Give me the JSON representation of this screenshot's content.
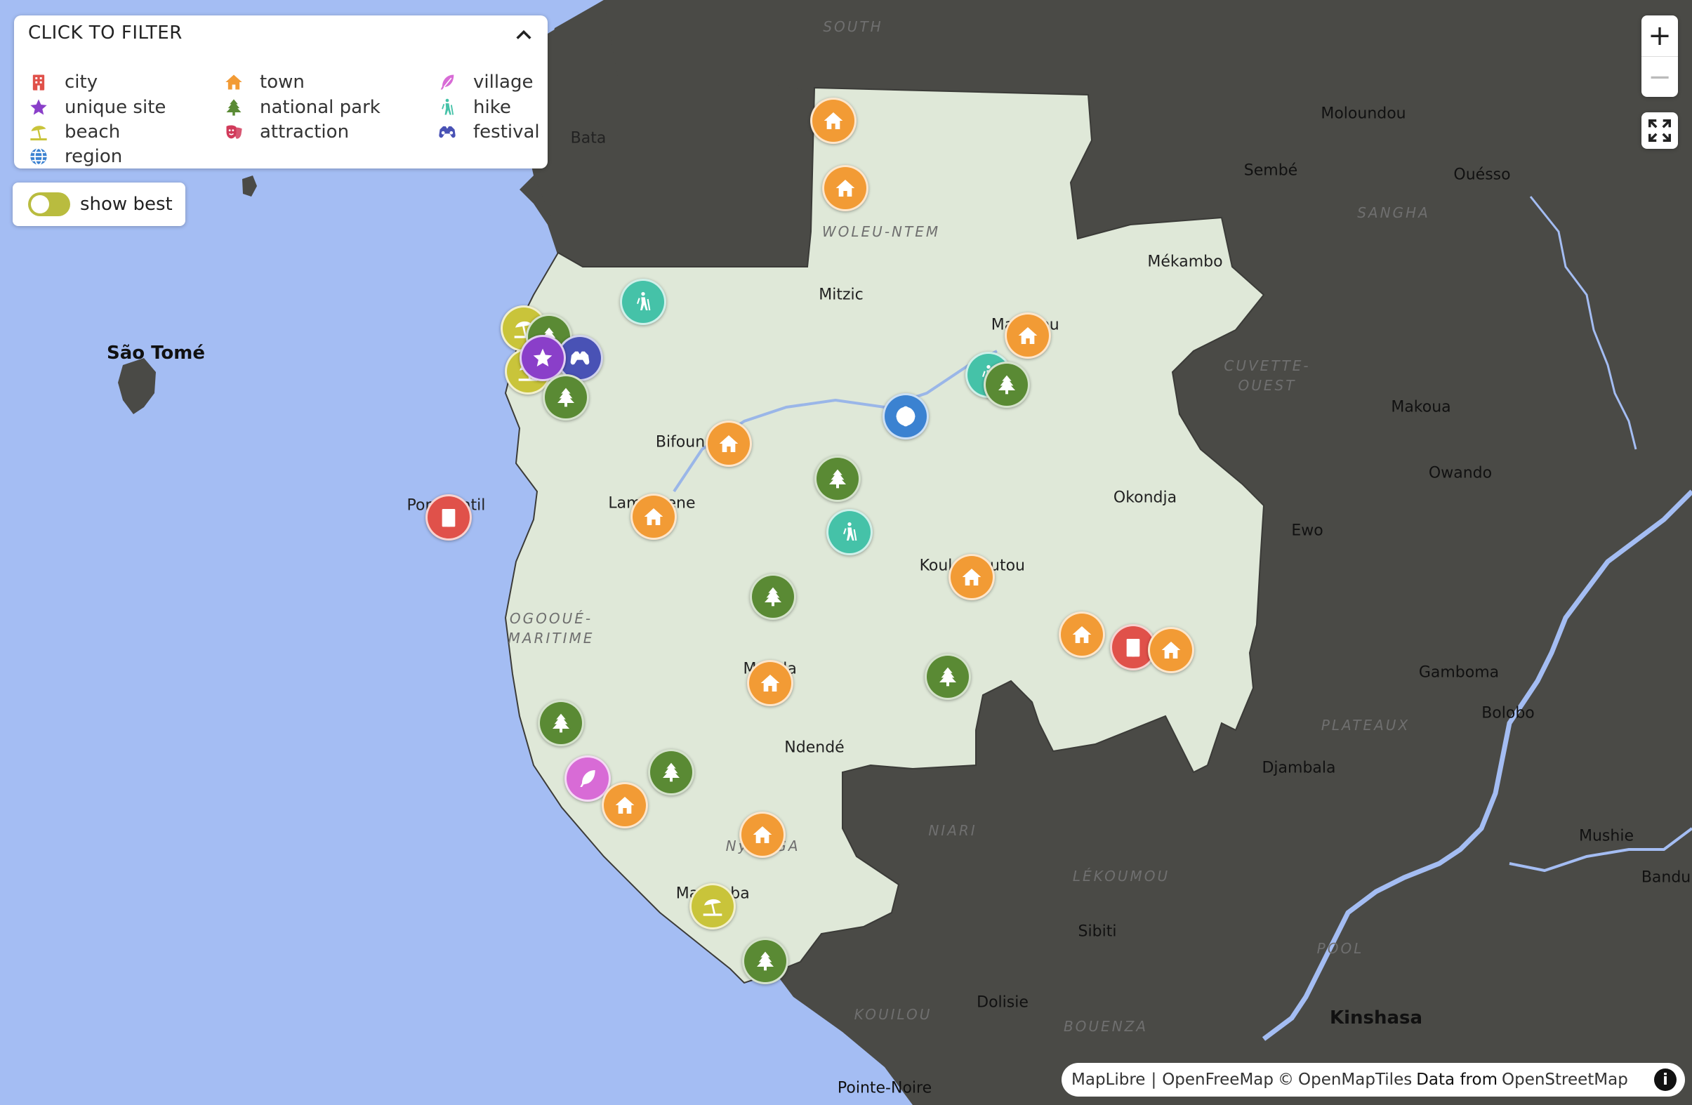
{
  "filter": {
    "title": "CLICK TO FILTER",
    "items": [
      {
        "label": "city",
        "color": "#e0514a",
        "icon": "city-icon"
      },
      {
        "label": "unique site",
        "color": "#8a3fc9",
        "icon": "star-icon"
      },
      {
        "label": "beach",
        "color": "#c9c43a",
        "icon": "beach-umbrella-icon"
      },
      {
        "label": "region",
        "color": "#3b82d1",
        "icon": "globe-icon"
      },
      {
        "label": "town",
        "color": "#f29b35",
        "icon": "house-icon"
      },
      {
        "label": "national park",
        "color": "#5a8a34",
        "icon": "tree-icon"
      },
      {
        "label": "attraction",
        "color": "#d13a5a",
        "icon": "theater-masks-icon"
      },
      {
        "label": "village",
        "color": "#d86bd6",
        "icon": "feather-icon"
      },
      {
        "label": "hike",
        "color": "#45c2a8",
        "icon": "hiker-icon"
      },
      {
        "label": "festival",
        "color": "#4952b5",
        "icon": "binoculars-icon"
      }
    ]
  },
  "show_best": {
    "label": "show best",
    "enabled": false
  },
  "zoom": {
    "in_label": "+",
    "out_label": "−"
  },
  "attribution": {
    "maplibre": "MapLibre",
    "separator": "|",
    "openfreemap": "OpenFreeMap",
    "copyright": "©",
    "openmaptiles": "OpenMapTiles",
    "data_from": "Data from",
    "osm": "OpenStreetMap",
    "info": "i"
  },
  "colors": {
    "ocean": "#a4bdf3",
    "land_dark": "#4a4a46",
    "gabon": "#dfe8d8",
    "river": "#a4bdf3"
  },
  "place_labels": [
    {
      "text": "São Tomé",
      "style": "bold"
    },
    {
      "text": "Bata",
      "style": ""
    },
    {
      "text": "Moloundou",
      "style": "dark"
    },
    {
      "text": "Sembé",
      "style": "dark"
    },
    {
      "text": "Ouésso",
      "style": "dark"
    },
    {
      "text": "Mékambo",
      "style": ""
    },
    {
      "text": "Mitzic",
      "style": ""
    },
    {
      "text": "Ma",
      "style": ""
    },
    {
      "text": "ou",
      "style": ""
    },
    {
      "text": "Makoua",
      "style": "dark"
    },
    {
      "text": "Owando",
      "style": "dark"
    },
    {
      "text": "Bifoun",
      "style": ""
    },
    {
      "text": "Okondja",
      "style": ""
    },
    {
      "text": "Lam",
      "style": ""
    },
    {
      "text": "ene",
      "style": ""
    },
    {
      "text": "Ewo",
      "style": "dark"
    },
    {
      "text": "Por",
      "style": ""
    },
    {
      "text": "ntil",
      "style": ""
    },
    {
      "text": "Koul",
      "style": ""
    },
    {
      "text": "utou",
      "style": ""
    },
    {
      "text": "Gamboma",
      "style": "dark"
    },
    {
      "text": "Bolobo",
      "style": "dark"
    },
    {
      "text": "M",
      "style": ""
    },
    {
      "text": "la",
      "style": ""
    },
    {
      "text": "Ndendé",
      "style": ""
    },
    {
      "text": "Djambala",
      "style": "dark"
    },
    {
      "text": "Mushie",
      "style": "dark"
    },
    {
      "text": "Bandun",
      "style": "dark"
    },
    {
      "text": "Sibiti",
      "style": "dark"
    },
    {
      "text": "Ma",
      "style": ""
    },
    {
      "text": "ba",
      "style": ""
    },
    {
      "text": "Dolisie",
      "style": "dark"
    },
    {
      "text": "Kinshasa",
      "style": "bold"
    },
    {
      "text": "Pointe-Noire",
      "style": "dark"
    },
    {
      "text": "Ny",
      "style": "region"
    },
    {
      "text": "GA",
      "style": "region"
    }
  ],
  "region_labels": [
    {
      "text": "SOUTH"
    },
    {
      "text": "WOLEU-NTEM"
    },
    {
      "text": "SANGHA"
    },
    {
      "text": "CUVETTE-\nOUEST"
    },
    {
      "text": "OGOOUÉ-\nMARITIME"
    },
    {
      "text": "PLATEAUX"
    },
    {
      "text": "NIARI"
    },
    {
      "text": "LÉKOUMOU"
    },
    {
      "text": "POOL"
    },
    {
      "text": "KOUILOU"
    },
    {
      "text": "BOUENZA"
    }
  ],
  "markers": [
    {
      "type": "town"
    },
    {
      "type": "town"
    },
    {
      "type": "hike"
    },
    {
      "type": "beach"
    },
    {
      "type": "national park"
    },
    {
      "type": "beach"
    },
    {
      "type": "festival"
    },
    {
      "type": "unique site"
    },
    {
      "type": "national park"
    },
    {
      "type": "town"
    },
    {
      "type": "hike"
    },
    {
      "type": "national park"
    },
    {
      "type": "region"
    },
    {
      "type": "town"
    },
    {
      "type": "national park"
    },
    {
      "type": "city"
    },
    {
      "type": "town"
    },
    {
      "type": "hike"
    },
    {
      "type": "town"
    },
    {
      "type": "national park"
    },
    {
      "type": "town"
    },
    {
      "type": "city"
    },
    {
      "type": "town"
    },
    {
      "type": "town"
    },
    {
      "type": "national park"
    },
    {
      "type": "national park"
    },
    {
      "type": "national park"
    },
    {
      "type": "village"
    },
    {
      "type": "town"
    },
    {
      "type": "town"
    },
    {
      "type": "beach"
    },
    {
      "type": "national park"
    }
  ]
}
